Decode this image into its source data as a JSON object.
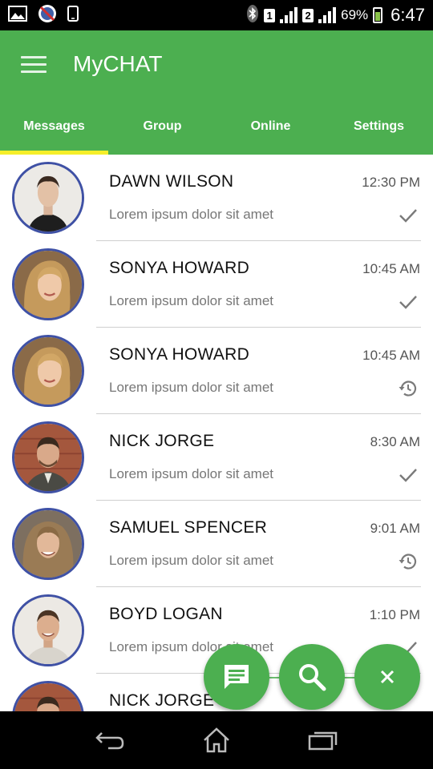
{
  "status_bar": {
    "sim1": "1",
    "sim2": "2",
    "battery_percent": "69%",
    "time": "6:47",
    "battery_level": 0.69,
    "icons": [
      "gallery-icon",
      "blocked-app-icon",
      "phone-icon",
      "bluetooth-icon",
      "signal-icon",
      "battery-icon"
    ]
  },
  "app_bar": {
    "title": "MyCHAT",
    "menu_icon": "hamburger-menu-icon"
  },
  "tabs": [
    {
      "label": "Messages",
      "active": true
    },
    {
      "label": "Group",
      "active": false
    },
    {
      "label": "Online",
      "active": false
    },
    {
      "label": "Settings",
      "active": false
    }
  ],
  "conversations": [
    {
      "name": "DAWN WILSON",
      "time": "12:30 PM",
      "message": "Lorem ipsum dolor sit amet",
      "status": "sent",
      "status_icon": "check-icon"
    },
    {
      "name": "SONYA HOWARD",
      "time": "10:45 AM",
      "message": "Lorem ipsum dolor sit amet",
      "status": "sent",
      "status_icon": "check-icon"
    },
    {
      "name": "SONYA HOWARD",
      "time": "10:45 AM",
      "message": "Lorem ipsum dolor sit amet",
      "status": "pending",
      "status_icon": "history-icon"
    },
    {
      "name": "NICK JORGE",
      "time": "8:30 AM",
      "message": "Lorem ipsum dolor sit amet",
      "status": "sent",
      "status_icon": "check-icon"
    },
    {
      "name": "SAMUEL SPENCER",
      "time": "9:01 AM",
      "message": "Lorem ipsum dolor sit amet",
      "status": "pending",
      "status_icon": "history-icon"
    },
    {
      "name": "BOYD LOGAN",
      "time": "1:10 PM",
      "message": "Lorem ipsum dolor sit amet",
      "status": "sent",
      "status_icon": "check-icon"
    },
    {
      "name": "NICK JORGE",
      "time": "",
      "message": "",
      "status": "",
      "status_icon": ""
    }
  ],
  "fabs": [
    {
      "icon": "chat-message-icon"
    },
    {
      "icon": "search-icon"
    },
    {
      "icon": "close-icon"
    }
  ],
  "nav_bar": {
    "icons": [
      "back-icon",
      "home-icon",
      "recent-apps-icon"
    ]
  },
  "colors": {
    "primary": "#4caf50",
    "tab_indicator": "#f5ee2a",
    "avatar_border": "#3f51a5"
  }
}
